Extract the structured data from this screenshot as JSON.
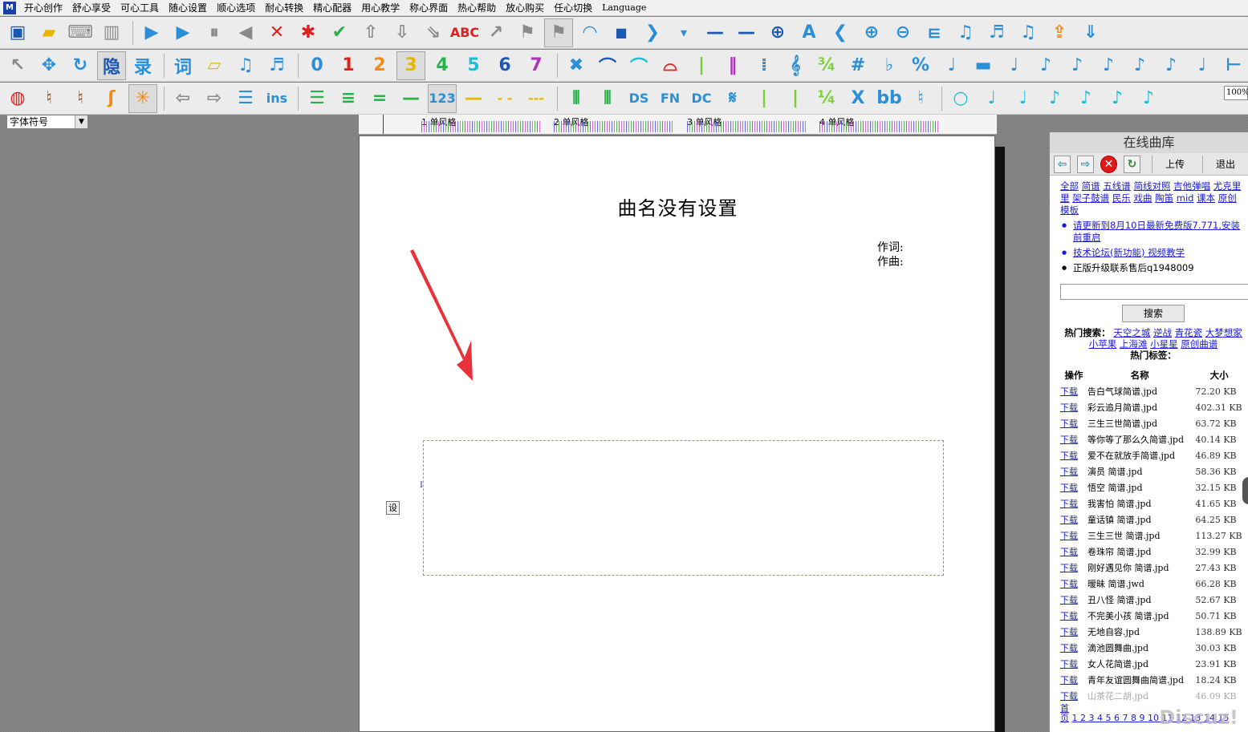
{
  "menu": [
    "开心创作",
    "舒心享受",
    "可心工具",
    "随心设置",
    "顺心选项",
    "耐心转换",
    "精心配器",
    "用心教学",
    "称心界面",
    "热心帮助",
    "放心购买",
    "任心切换",
    "Language"
  ],
  "app_icon": "M",
  "toolbar2": {
    "hide": "隐",
    "record": "录",
    "word": "词",
    "n0": "0",
    "n1": "1",
    "n2": "2",
    "n3": "3",
    "n4": "4",
    "n5": "5",
    "n6": "6",
    "n7": "7",
    "fraction": "¾",
    "sharp": "#",
    "flat": "♭",
    "percent": "%"
  },
  "toolbar3": {
    "ins": "ins",
    "n123": "123",
    "ds": "DS",
    "fn": "FN",
    "dc": "DC",
    "x": "X",
    "bb": "bb"
  },
  "zoom": "100%",
  "font_combo": {
    "value": "字体符号"
  },
  "ruler": [
    {
      "num": "1",
      "label": "单风格"
    },
    {
      "num": "2",
      "label": "单风格"
    },
    {
      "num": "3",
      "label": "单风格"
    },
    {
      "num": "4",
      "label": "单风格"
    }
  ],
  "score": {
    "title": "曲名没有设置",
    "lyricist_label": "作词:",
    "composer_label": "作曲:",
    "cursor": "I",
    "set_button": "设"
  },
  "library": {
    "title": "在线曲库",
    "upload": "上传",
    "exit": "退出",
    "categories": [
      "全部",
      "简谱",
      "五线谱",
      "简线对照",
      "吉他弹唱",
      "尤克里里",
      "架子鼓谱",
      "民乐",
      "戏曲",
      "陶笛",
      "mid",
      "课本",
      "原创",
      "模板"
    ],
    "notices": [
      {
        "text": "请更新到8月10日最新免费版7.771,安装前重启",
        "link": true
      },
      {
        "text": "技术论坛(新功能) 视频教学",
        "link": true
      },
      {
        "text": "正版升级联系售后q1948009",
        "link": false
      }
    ],
    "search_placeholder": "",
    "search_button": "搜索",
    "hot_search_label": "热门搜索：",
    "hot_searches": [
      "天空之城",
      "逆战",
      "青花瓷",
      "大梦想家",
      "小苹果",
      "上海滩",
      "小星星",
      "原创曲谱"
    ],
    "hot_tags_label": "热门标签：",
    "columns": {
      "action": "操作",
      "name": "名称",
      "size": "大小"
    },
    "download_label": "下载",
    "files": [
      {
        "name": "告白气球简谱.jpd",
        "size": "72.20 KB"
      },
      {
        "name": "彩云追月简谱.jpd",
        "size": "402.31 KB"
      },
      {
        "name": "三生三世简谱.jpd",
        "size": "63.72 KB"
      },
      {
        "name": "等你等了那么久简谱.jpd",
        "size": "40.14 KB"
      },
      {
        "name": "爱不在就放手简谱.jpd",
        "size": "46.89 KB"
      },
      {
        "name": "演员 简谱.jpd",
        "size": "58.36 KB"
      },
      {
        "name": "悟空 简谱.jpd",
        "size": "32.15 KB"
      },
      {
        "name": "我害怕 简谱.jpd",
        "size": "41.65 KB"
      },
      {
        "name": "童话镇 简谱.jpd",
        "size": "64.25 KB"
      },
      {
        "name": "三生三世 简谱.jpd",
        "size": "113.27 KB"
      },
      {
        "name": "卷珠帘 简谱.jpd",
        "size": "32.99 KB"
      },
      {
        "name": "刚好遇见你 简谱.jpd",
        "size": "27.43 KB"
      },
      {
        "name": "暧昧 简谱.jwd",
        "size": "66.28 KB"
      },
      {
        "name": "丑八怪 简谱.jpd",
        "size": "52.67 KB"
      },
      {
        "name": "不完美小孩 简谱.jpd",
        "size": "50.71 KB"
      },
      {
        "name": "无地自容.jpd",
        "size": "138.89 KB"
      },
      {
        "name": "滴池圆舞曲.jpd",
        "size": "30.03 KB"
      },
      {
        "name": "女人花简谱.jpd",
        "size": "23.91 KB"
      },
      {
        "name": "青年友谊圆舞曲简谱.jpd",
        "size": "18.24 KB"
      },
      {
        "name": "山茶花二胡.jpd",
        "size": "46.09 KB"
      }
    ],
    "pager_first": "首",
    "pager_page": "页",
    "pager_numbers": "1 2 3 4 5 6 7 8 9 10 11 12 13 14 15",
    "watermark": "Discuz!"
  }
}
